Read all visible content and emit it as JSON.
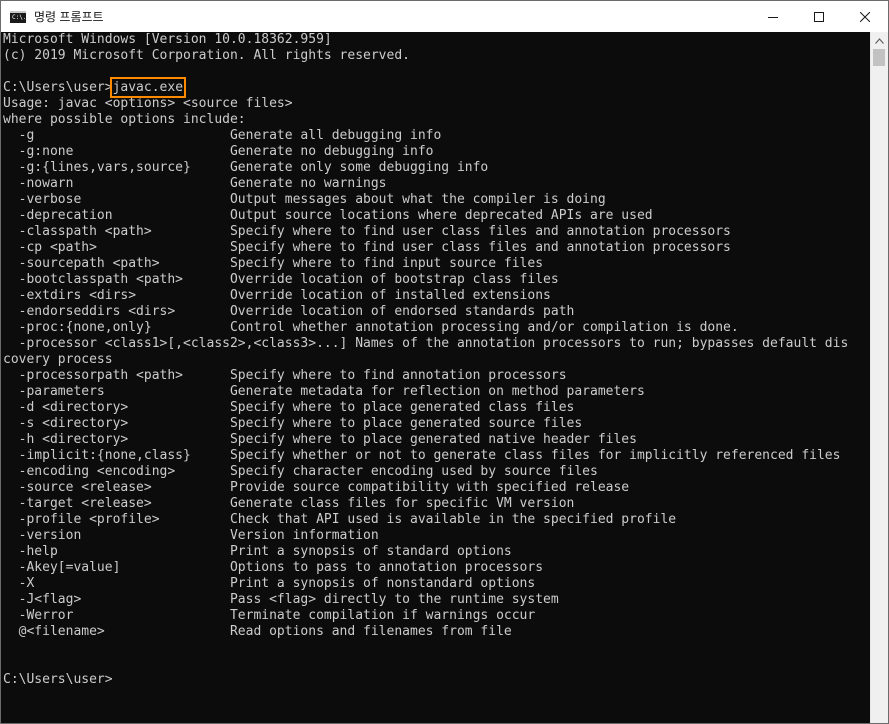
{
  "window": {
    "title": "명령 프롬프트",
    "icon_label": "C:\\.",
    "controls": [
      "minimize-icon",
      "maximize-icon",
      "close-icon"
    ]
  },
  "terminal": {
    "lines": [
      "Microsoft Windows [Version 10.0.18362.959]",
      "(c) 2019 Microsoft Corporation. All rights reserved.",
      "",
      "__PROMPT_CMD__",
      "Usage: javac <options> <source files>",
      "where possible options include:",
      "  -g                         Generate all debugging info",
      "  -g:none                    Generate no debugging info",
      "  -g:{lines,vars,source}     Generate only some debugging info",
      "  -nowarn                    Generate no warnings",
      "  -verbose                   Output messages about what the compiler is doing",
      "  -deprecation               Output source locations where deprecated APIs are used",
      "  -classpath <path>          Specify where to find user class files and annotation processors",
      "  -cp <path>                 Specify where to find user class files and annotation processors",
      "  -sourcepath <path>         Specify where to find input source files",
      "  -bootclasspath <path>      Override location of bootstrap class files",
      "  -extdirs <dirs>            Override location of installed extensions",
      "  -endorseddirs <dirs>       Override location of endorsed standards path",
      "  -proc:{none,only}          Control whether annotation processing and/or compilation is done.",
      "  -processor <class1>[,<class2>,<class3>...] Names of the annotation processors to run; bypasses default dis",
      "covery process",
      "  -processorpath <path>      Specify where to find annotation processors",
      "  -parameters                Generate metadata for reflection on method parameters",
      "  -d <directory>             Specify where to place generated class files",
      "  -s <directory>             Specify where to place generated source files",
      "  -h <directory>             Specify where to place generated native header files",
      "  -implicit:{none,class}     Specify whether or not to generate class files for implicitly referenced files",
      "  -encoding <encoding>       Specify character encoding used by source files",
      "  -source <release>          Provide source compatibility with specified release",
      "  -target <release>          Generate class files for specific VM version",
      "  -profile <profile>         Check that API used is available in the specified profile",
      "  -version                   Version information",
      "  -help                      Print a synopsis of standard options",
      "  -Akey[=value]              Options to pass to annotation processors",
      "  -X                         Print a synopsis of nonstandard options",
      "  -J<flag>                   Pass <flag> directly to the runtime system",
      "  -Werror                    Terminate compilation if warnings occur",
      "  @<filename>                Read options and filenames from file",
      "",
      "",
      "C:\\Users\\user>"
    ],
    "prompt": "C:\\Users\\user>",
    "command": "javac.exe"
  },
  "colors": {
    "terminal_bg": "#0c0c0c",
    "terminal_fg": "#cccccc",
    "highlight": "#ff8a00"
  }
}
